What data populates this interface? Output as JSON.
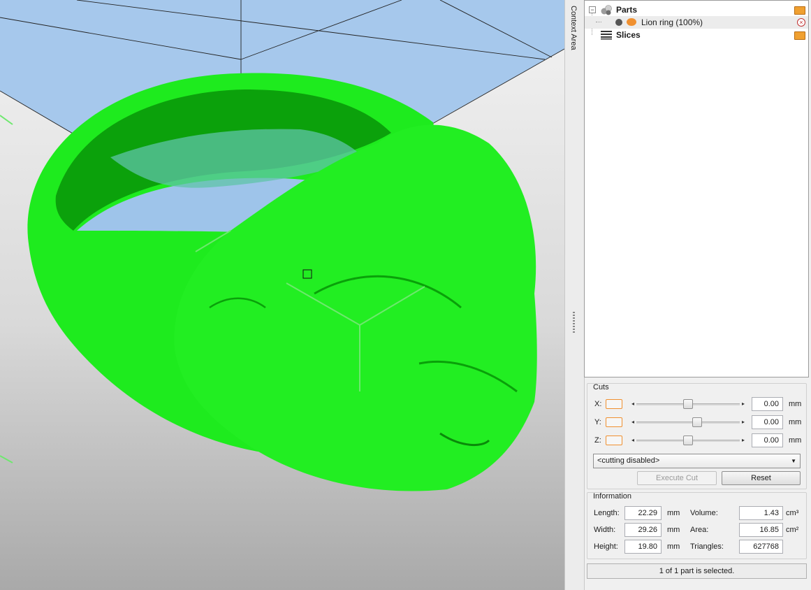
{
  "context_area": {
    "label": "Context Area"
  },
  "tree": {
    "parts_label": "Parts",
    "part_item_label": "Lion ring (100%)",
    "slices_label": "Slices"
  },
  "cuts": {
    "title": "Cuts",
    "axes": [
      {
        "label": "X:",
        "value": "0.00",
        "unit": "mm",
        "position": 0.5
      },
      {
        "label": "Y:",
        "value": "0.00",
        "unit": "mm",
        "position": 0.6
      },
      {
        "label": "Z:",
        "value": "0.00",
        "unit": "mm",
        "position": 0.5
      }
    ],
    "mode": "<cutting disabled>",
    "execute_label": "Execute Cut",
    "reset_label": "Reset"
  },
  "information": {
    "title": "Information",
    "length_label": "Length:",
    "length_value": "22.29",
    "length_unit": "mm",
    "width_label": "Width:",
    "width_value": "29.26",
    "width_unit": "mm",
    "height_label": "Height:",
    "height_value": "19.80",
    "height_unit": "mm",
    "volume_label": "Volume:",
    "volume_value": "1.43",
    "volume_unit": "cm³",
    "area_label": "Area:",
    "area_value": "16.85",
    "area_unit": "cm²",
    "triangles_label": "Triangles:",
    "triangles_value": "627768"
  },
  "status": {
    "text": "1 of 1 part is selected."
  },
  "colors": {
    "model": "#1eeb1e",
    "platform": "#a6c8ec",
    "accent": "#f09030"
  }
}
